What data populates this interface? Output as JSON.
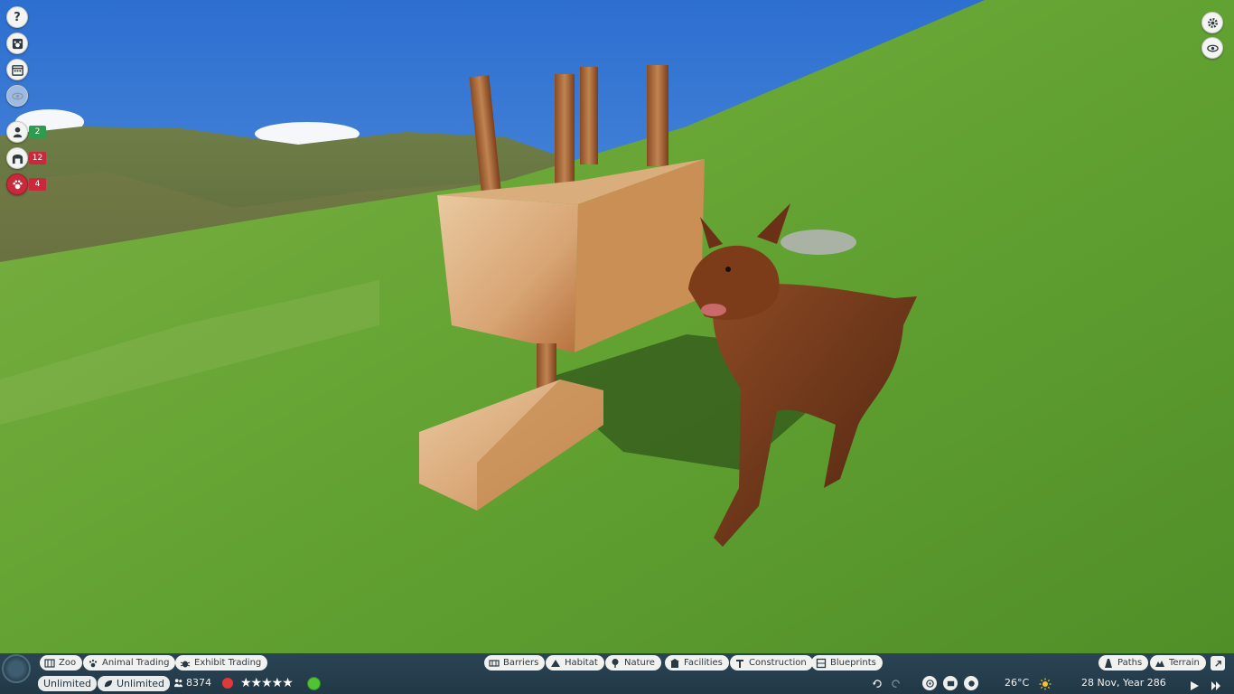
{
  "left_hud": {
    "buttons": [
      {
        "icon": "help-icon",
        "glyph": "?"
      },
      {
        "icon": "animal-paw-icon"
      },
      {
        "icon": "calendar-icon"
      },
      {
        "icon": "eye-visibility-icon"
      }
    ],
    "stats": [
      {
        "icon": "staff-icon",
        "value": "2",
        "color": "#2e9c4c"
      },
      {
        "icon": "habitat-gate-icon",
        "value": "12",
        "color": "#c9293a"
      },
      {
        "icon": "paw-alert-icon",
        "value": "4",
        "color": "#c9293a"
      }
    ]
  },
  "right_hud": {
    "buttons": [
      {
        "icon": "settings-gear-icon"
      },
      {
        "icon": "camera-view-icon"
      }
    ]
  },
  "bottom_bar": {
    "left_tabs": [
      {
        "label": "Zoo",
        "icon": "zoo-icon"
      },
      {
        "label": "Animal Trading",
        "icon": "paw-icon"
      },
      {
        "label": "Exhibit Trading",
        "icon": "bug-icon"
      }
    ],
    "center_tabs": [
      {
        "label": "Barriers",
        "icon": "barrier-icon"
      },
      {
        "label": "Habitat",
        "icon": "habitat-icon"
      },
      {
        "label": "Nature",
        "icon": "tree-icon"
      },
      {
        "label": "Facilities",
        "icon": "facilities-icon"
      },
      {
        "label": "Construction",
        "icon": "construction-icon"
      },
      {
        "label": "Blueprints",
        "icon": "blueprint-icon"
      }
    ],
    "right_tabs": [
      {
        "label": "Paths",
        "icon": "paths-icon"
      },
      {
        "label": "Terrain",
        "icon": "terrain-icon"
      }
    ],
    "status": {
      "money": "Unlimited",
      "research": "Unlimited",
      "guests": "8374",
      "rating_stars": "★★★★★",
      "temperature": "26°C",
      "date": "28 Nov, Year 286"
    },
    "colors": {
      "bar": "#253e4d",
      "pill": "#f1f1ef",
      "guest_happy": "#4fc236",
      "alert_red": "#e0393c"
    }
  }
}
